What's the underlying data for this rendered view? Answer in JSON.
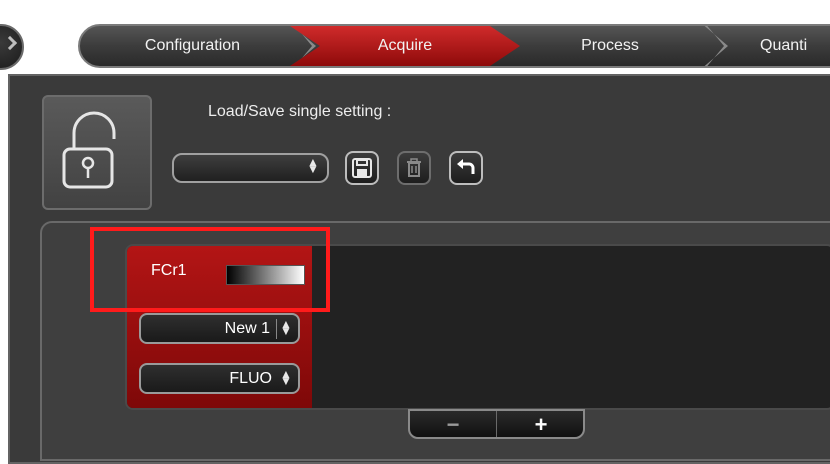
{
  "workflow": {
    "steps": [
      {
        "label": "Configuration"
      },
      {
        "label": "Acquire"
      },
      {
        "label": "Process"
      },
      {
        "label": "Quanti"
      }
    ],
    "active_step": "Acquire"
  },
  "settings": {
    "load_save_label": "Load/Save single setting :",
    "select_value": "",
    "icons": [
      "save-icon",
      "trash-icon",
      "undo-icon"
    ]
  },
  "channel": {
    "name": "FCr1",
    "setting_value": "New 1",
    "mode_value": "FLUO",
    "color_gradient": [
      "#000000",
      "#ffffff"
    ]
  },
  "stepper": {
    "minus_label": "−",
    "plus_label": "+"
  },
  "colors": {
    "accent_red": "#b31515",
    "highlight": "#ff1b1b",
    "panel": "#3a3a3a"
  }
}
